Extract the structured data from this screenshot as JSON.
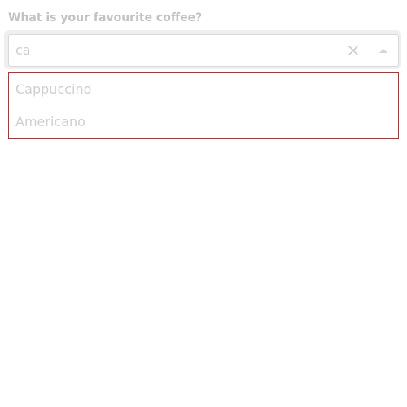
{
  "field": {
    "label": "What is your favourite coffee?",
    "input_value": "ca",
    "clear_icon": "close-icon",
    "toggle_icon": "caret-up-icon"
  },
  "listbox": {
    "options": [
      {
        "label": "Cappuccino"
      },
      {
        "label": "Americano"
      }
    ]
  },
  "colors": {
    "listbox_border": "#e02020",
    "text_muted": "#cfcfcf",
    "label_text": "#c2c2c2"
  }
}
